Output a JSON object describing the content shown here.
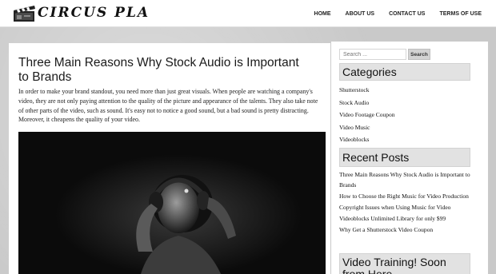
{
  "site": {
    "logo_text": "CIRCUS PLA"
  },
  "nav": {
    "items": [
      "HOME",
      "ABOUT US",
      "CONTACT US",
      "TERMS OF USE"
    ]
  },
  "post": {
    "title": "Three Main Reasons Why Stock Audio is Important to Brands",
    "excerpt": "In order to make your brand standout, you need more than just great visuals. When people are watching a company's video, they are not only paying attention to the quality of the picture and appearance of the talents. They also take note of other parts of the video, such as sound. It's easy not to notice a good sound, but a bad sound is pretty distracting. Moreover, it cheapens the quality of your video."
  },
  "sidebar": {
    "search": {
      "placeholder": "Search ...",
      "button_label": "Search"
    },
    "categories": {
      "title": "Categories",
      "items": [
        "Shutterstock",
        "Stock Audio",
        "Video Footage Coupon",
        "Video Music",
        "Videoblocks"
      ]
    },
    "recent_posts": {
      "title": "Recent Posts",
      "items": [
        "Three Main Reasons Why Stock Audio is Important to Brands",
        "How to Choose the Right Music for Video Production",
        "Copyright Issues when Using Music for Video",
        "Videoblocks Unlimited Library for only $99",
        "Why Get a Shutterstock Video Coupon"
      ]
    },
    "training": {
      "title": "Video Training! Soon from Here"
    }
  }
}
